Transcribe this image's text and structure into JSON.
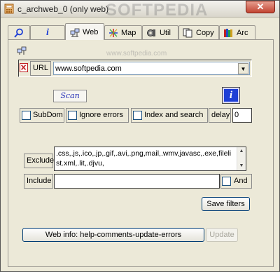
{
  "window": {
    "title": "c_archweb_0 (only web)",
    "watermark": "SOFTPEDIA",
    "close_glyph": "✕"
  },
  "tabs": [
    {
      "icon": "search-icon",
      "label": ""
    },
    {
      "icon": "info-icon",
      "label": "i"
    },
    {
      "icon": "web-icon",
      "label": "Web"
    },
    {
      "icon": "map-icon",
      "label": "Map"
    },
    {
      "icon": "util-icon",
      "label": "Util"
    },
    {
      "icon": "copy-icon",
      "label": "Copy"
    },
    {
      "icon": "archive-books-icon",
      "label": "Arc"
    }
  ],
  "panel": {
    "panel_watermark": "www.softpedia.com",
    "url_label": "URL",
    "url_value": "www.softpedia.com",
    "scan_button": "Scan",
    "info_button": "i",
    "subdom_label": "SubDom",
    "ignore_errors_label": "Ignore errors",
    "index_search_label": "Index and search",
    "delay_label": "delay",
    "delay_value": "0",
    "exclude_label": "Exclude",
    "exclude_value": ".css,.js,.ico,.jp,.gif,.avi,.png,mail,.wmv,javasc,.exe,filelist.xml,.lit,.djvu,",
    "include_label": "Include",
    "include_value": "",
    "and_label": "And",
    "save_filters_button": "Save filters",
    "web_info_button": "Web info: help-comments-update-errors",
    "update_button": "Update"
  },
  "colors": {
    "accent_blue": "#1e3fd6",
    "close_red": "#c24431",
    "scan_text": "#1f2ab5"
  }
}
